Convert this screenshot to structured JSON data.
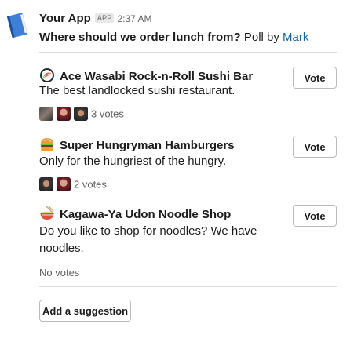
{
  "message": {
    "app_name": "Your App",
    "app_badge": "APP",
    "time": "2:37 AM",
    "question": "Where should we order lunch from?",
    "poll_by_prefix": " Poll by ",
    "poll_author": "Mark"
  },
  "options": [
    {
      "title": "Ace Wasabi Rock-n-Roll Sushi Bar",
      "description": "The best landlocked sushi restaurant.",
      "emoji_icon": "sushi-icon",
      "vote_label": "Vote",
      "votes_text": "3 votes",
      "voter_count": 3
    },
    {
      "title": "Super Hungryman Hamburgers",
      "description": "Only for the hungriest of the hungry.",
      "emoji_icon": "hamburger-icon",
      "vote_label": "Vote",
      "votes_text": "2 votes",
      "voter_count": 2
    },
    {
      "title": "Kagawa-Ya Udon Noodle Shop",
      "description": "Do you like to shop for noodles? We have noodles.",
      "emoji_icon": "ramen-icon",
      "vote_label": "Vote",
      "votes_text": "No votes",
      "voter_count": 0
    }
  ],
  "add_suggestion_label": "Add a suggestion",
  "colors": {
    "link": "#1264a3",
    "muted": "#616061",
    "divider": "#dddddd"
  }
}
